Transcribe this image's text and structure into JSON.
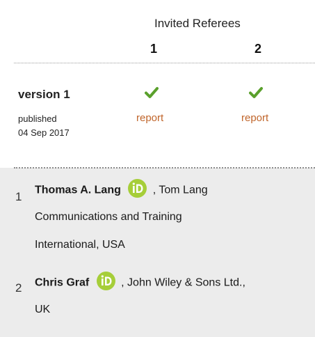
{
  "header": {
    "title": "Invited Referees",
    "referee_numbers": [
      "1",
      "2"
    ]
  },
  "version": {
    "label": "version 1",
    "published_label": "published",
    "published_date": "04 Sep 2017",
    "reports": [
      {
        "status_icon": "check-icon",
        "link_label": "report"
      },
      {
        "status_icon": "check-icon",
        "link_label": "report"
      }
    ]
  },
  "referees": [
    {
      "number": "1",
      "name": "Thomas A. Lang",
      "affiliation_line1": ", Tom Lang",
      "affiliation_line2": "Communications and Training",
      "affiliation_line3": "International, USA"
    },
    {
      "number": "2",
      "name": "Chris Graf",
      "affiliation_line1": ", John Wiley & Sons Ltd.,",
      "affiliation_line2": "UK"
    }
  ],
  "colors": {
    "check": "#5aa02c",
    "report_link": "#c0652b",
    "orcid": "#a6ce39",
    "panel_bg": "#ececec"
  }
}
